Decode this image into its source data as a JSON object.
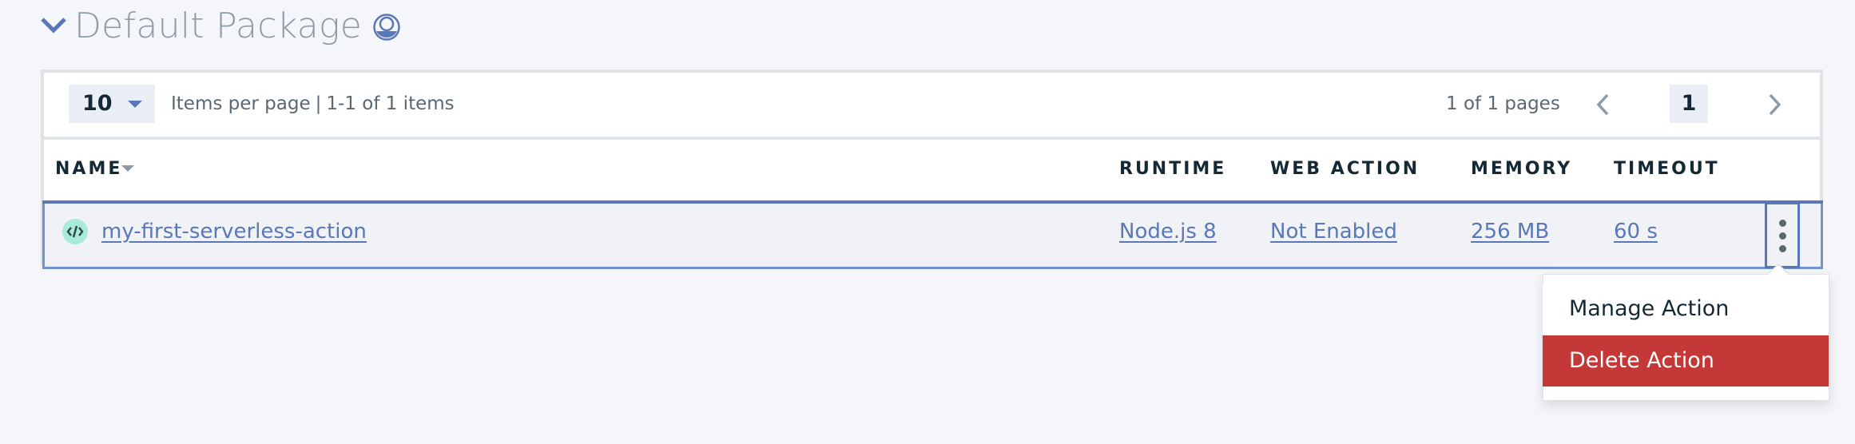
{
  "package": {
    "title": "Default Package",
    "expanded": true,
    "icons": {
      "toggle": "chevron-down-icon",
      "badge": "package-ring-icon"
    }
  },
  "pagination": {
    "items_per_page": "10",
    "items_per_page_label": "Items per page",
    "separator": "|",
    "range_label": "1-1 of 1 items",
    "pages_label": "1 of 1 pages",
    "current_page": "1",
    "icons": {
      "prev": "chevron-left-icon",
      "next": "chevron-right-icon",
      "select": "caret-down-icon"
    }
  },
  "table": {
    "columns": [
      {
        "key": "name",
        "label": "NAME",
        "sortable": true
      },
      {
        "key": "runtime",
        "label": "RUNTIME"
      },
      {
        "key": "web_action",
        "label": "WEB ACTION"
      },
      {
        "key": "memory",
        "label": "MEMORY"
      },
      {
        "key": "timeout",
        "label": "TIMEOUT"
      }
    ],
    "rows": [
      {
        "name": "my-first-serverless-action",
        "runtime": "Node.js 8",
        "web_action": "Not Enabled",
        "memory": "256 MB",
        "timeout": "60 s",
        "icon": "code-icon"
      }
    ]
  },
  "overflow_menu": {
    "open": true,
    "items": [
      {
        "label": "Manage Action"
      },
      {
        "label": "Delete Action",
        "danger": true
      }
    ]
  },
  "colors": {
    "background": "#f4f6fa",
    "link": "#5a78b7",
    "selected_outline": "#6f93d5",
    "danger": "#c53838",
    "icon_badge": "#a7ebd8",
    "title": "#8c9ba5"
  }
}
